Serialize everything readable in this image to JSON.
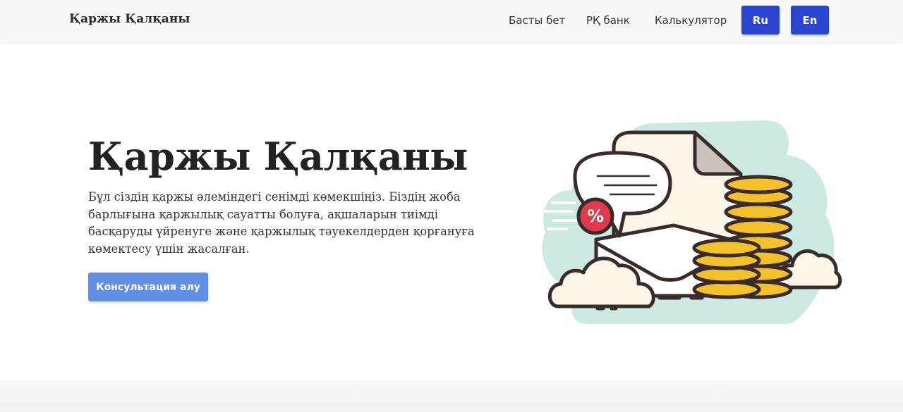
{
  "navbar": {
    "brand": "Қаржы Қалқаны",
    "links": [
      {
        "label": "Басты бет"
      },
      {
        "label": "РҚ банк"
      },
      {
        "label": "Калькулятор"
      }
    ],
    "languages": [
      {
        "label": "Ru"
      },
      {
        "label": "En"
      }
    ],
    "accent_color": "#2b45d0"
  },
  "hero": {
    "title": "Қаржы Қалқаны",
    "description": "Бұл сіздің қаржы әлеміндегі сенімді көмекшіңіз. Біздің жоба барлығына қаржылық сауатты болуға, ақшаларын тиімді басқаруды үйренуге және қаржылық тәуекелдерден қорғануға көмектесу үшін жасалған.",
    "cta_label": "Консультация алу",
    "cta_color": "#5f8fe6",
    "illustration": {
      "icon": "finance-illustration",
      "badge_text": "%",
      "colors": {
        "backdrop": "#cde9e3",
        "coin": "#f3c12b",
        "badge": "#e03b4c",
        "outline": "#3a2b2b",
        "paper": "#fdf7ea"
      }
    }
  }
}
